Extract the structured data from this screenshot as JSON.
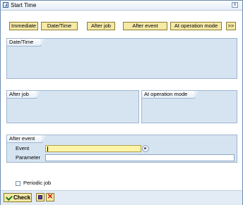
{
  "window": {
    "title": "Start Time",
    "close_glyph": "x"
  },
  "toolbar": {
    "buttons": [
      "Immediate",
      "Date/Time",
      "After job",
      "After event",
      "At operation mode",
      ">>"
    ]
  },
  "sections": {
    "date_time": "Date/Time",
    "after_job": "After job",
    "at_operation_mode": "At operation mode",
    "after_event": "After event"
  },
  "after_event": {
    "event_label": "Event",
    "event_value": "",
    "parameter_label": "Parameter",
    "parameter_value": ""
  },
  "periodic_job": {
    "label": "Periodic job",
    "checked": false
  },
  "footer": {
    "check_label": "Check"
  },
  "colors": {
    "button_fill": "#f5e9a6",
    "panel_fill": "#d6e4f1",
    "required_field": "#fff5a8"
  }
}
